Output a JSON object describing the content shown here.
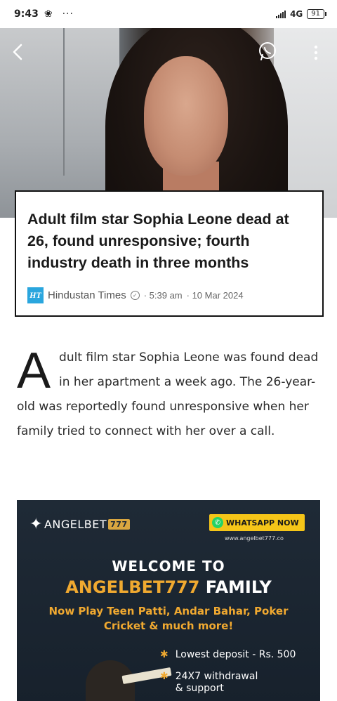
{
  "status_bar": {
    "time": "9:43",
    "dots": "···",
    "network": "4G",
    "battery": "91"
  },
  "hero": {
    "back_icon": "chevron-left-icon",
    "share_icon": "whatsapp-icon",
    "menu_icon": "more-vertical-icon"
  },
  "article": {
    "headline": "Adult film star Sophia Leone dead at 26, found unresponsive; fourth industry death in three months",
    "source_logo": "HT",
    "source": "Hindustan Times",
    "time": "· 5:39 am",
    "date": "· 10 Mar 2024",
    "dropcap": "A",
    "body": "dult film star Sophia Leone was found dead in her apartment a week ago. The 26-year-old was reportedly found unresponsive when her family tried to connect with her over a call."
  },
  "ad": {
    "brand_text": "ANGELBET",
    "brand_num": "777",
    "whatsapp_label": "WHATSAPP NOW",
    "url": "www.angelbet777.co",
    "welcome": "WELCOME TO",
    "family_brand": "ANGELBET777",
    "family_word": "FAMILY",
    "games_line1": "Now Play Teen Patti, Andar Bahar, Poker",
    "games_line2": "Cricket & much more!",
    "bullets": [
      "Lowest deposit - Rs. 500",
      "24X7 withdrawal",
      "& support"
    ]
  },
  "colors": {
    "ad_bg": "#1f2a36",
    "ad_accent": "#f0a930",
    "whatsapp_btn": "#f5c518",
    "ht_blue": "#2aa6de"
  }
}
